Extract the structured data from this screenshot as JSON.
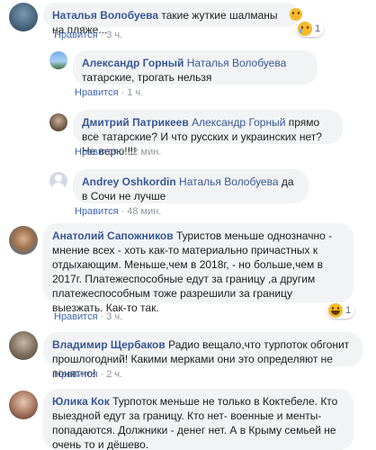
{
  "comments": [
    {
      "author": "Наталья Волобуева",
      "text": " такие жуткие шалманы на пляже...",
      "like": "Нравится",
      "time": "3 ч.",
      "reaction_count": "1"
    },
    {
      "author": "Александр Горный",
      "mention": "Наталья Волобуева",
      "text": " татарские, трогать нельзя",
      "like": "Нравится",
      "time": "1 ч."
    },
    {
      "author": "Дмитрий Патрикеев",
      "mention": "Александр Горный",
      "text": " прямо все татарские? И что русских и украинских нет? Не верю!!!!",
      "like": "Нравится",
      "time": "52 мин."
    },
    {
      "author": "Andrey Oshkordin",
      "mention": "Наталья Волобуева",
      "text": " да в Сочи не лучше",
      "like": "Нравится",
      "time": "48 мин."
    },
    {
      "author": "Анатолий Сапожников",
      "text": " Туристов меньше однозначно - мнение всех - хоть как-то материально причастных к отдыхающим. Меньше,чем в 2018г, - но больше,чем в 2017г. Платежеспособные едут за границу ,а другим платежеспособным тоже разрешили за границу выезжать. Как-то так.",
      "like": "Нравится",
      "time": "3 ч.",
      "reaction_count": "1"
    },
    {
      "author": "Владимир Щербаков",
      "text": " Радио вещало,что турпоток обгонит прошлогодний! Какими мерками они это определяют не понятно!",
      "like": "Нравится",
      "time": "2 ч."
    },
    {
      "author": "Юлика Кок",
      "text": " Турпоток меньше не только в Коктебеле. Кто выездной едут за границу. Кто нет- военные и менты- попадаются. Должники - денег нет. А в Крыму семьей не очень то и дёшево."
    }
  ],
  "separator": "·",
  "colors": {
    "link": "#385898",
    "bubble": "#f2f3f5",
    "meta": "#90949c"
  }
}
